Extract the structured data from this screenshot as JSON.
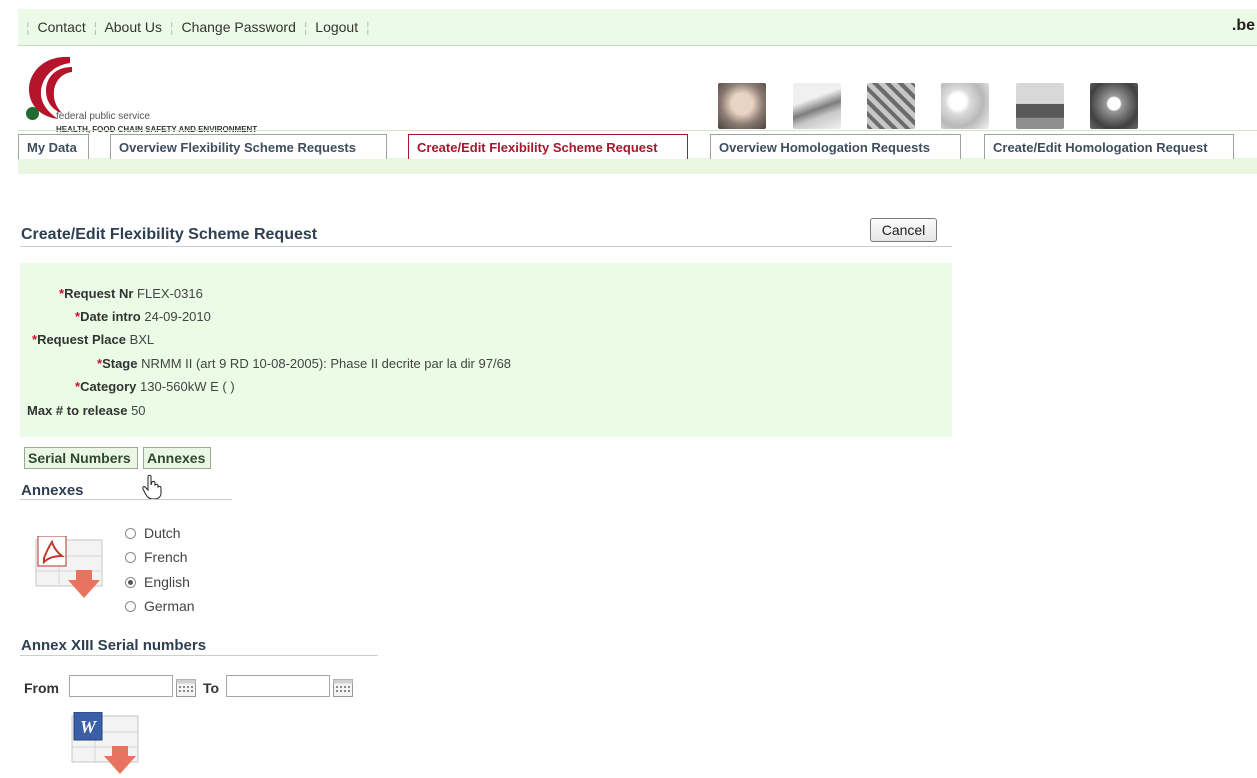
{
  "topbar": {
    "links": [
      "Contact",
      "About Us",
      "Change Password",
      "Logout"
    ],
    "brand": ".be"
  },
  "header": {
    "org_line1": "federal public service",
    "org_line2": "HEALTH, FOOD CHAIN SAFETY AND ENVIRONMENT",
    "photos": [
      "child-photo",
      "hands-photo",
      "wheelchair-photo",
      "pills-photo",
      "horse-photo",
      "dandelion-photo"
    ]
  },
  "tabs": [
    {
      "label": "My Data",
      "active": false
    },
    {
      "label": "Overview Flexibility Scheme Requests",
      "active": false
    },
    {
      "label": "Create/Edit  Flexibility Scheme Request",
      "active": true
    },
    {
      "label": "Overview  Homologation Requests",
      "active": false
    },
    {
      "label": "Create/Edit  Homologation Request",
      "active": false
    }
  ],
  "page": {
    "title": "Create/Edit Flexibility Scheme Request",
    "cancel_label": "Cancel"
  },
  "request": {
    "request_nr_label": "Request Nr",
    "request_nr": "FLEX-0316",
    "date_intro_label": "Date intro",
    "date_intro": "24-09-2010",
    "request_place_label": "Request Place",
    "request_place": "BXL",
    "stage_label": "Stage",
    "stage": "NRMM II (art 9 RD 10-08-2005): Phase II decrite par la dir 97/68",
    "category_label": "Category",
    "category": "130-560kW E ( )",
    "max_release_label": "Max # to release",
    "max_release": "50",
    "required_marker": "*"
  },
  "subtabs": {
    "serial_numbers": "Serial Numbers",
    "annexes": "Annexes"
  },
  "annexes": {
    "title": "Annexes",
    "languages": [
      {
        "label": "Dutch",
        "selected": false
      },
      {
        "label": "French",
        "selected": false
      },
      {
        "label": "English",
        "selected": true
      },
      {
        "label": "German",
        "selected": false
      }
    ]
  },
  "serials": {
    "title": "Annex XIII Serial numbers",
    "from_label": "From",
    "to_label": "To",
    "from_value": "",
    "to_value": ""
  },
  "colors": {
    "accent_red": "#a3182d",
    "panel_green": "#eafbe6",
    "title_blue": "#2f3f52"
  }
}
